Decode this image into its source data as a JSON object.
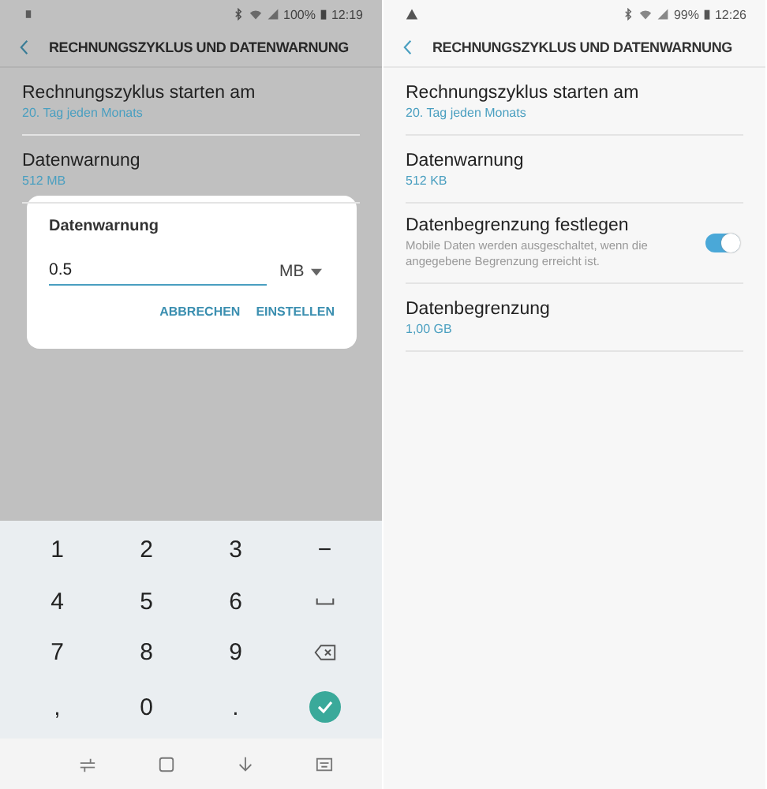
{
  "screens": [
    {
      "status": {
        "battery": "100%",
        "time": "12:19",
        "alert": false
      },
      "header": {
        "title": "RECHNUNGSZYKLUS UND DATENWARNUNG"
      },
      "dimmed": true,
      "items": [
        {
          "kind": "text",
          "title": "Rechnungszyklus starten am",
          "subtitle": "20. Tag jeden Monats"
        },
        {
          "kind": "text",
          "title": "Datenwarnung",
          "subtitle": "512 MB"
        }
      ],
      "dialog": {
        "title": "Datenwarnung",
        "value": "0.5",
        "unit": "MB",
        "buttons": [
          "ABBRECHEN",
          "EINSTELLEN"
        ]
      },
      "keyboard": {
        "keys": [
          {
            "kind": "char",
            "label": "1"
          },
          {
            "kind": "char",
            "label": "2"
          },
          {
            "kind": "char",
            "label": "3"
          },
          {
            "kind": "char",
            "label": "−"
          },
          {
            "kind": "char",
            "label": "4"
          },
          {
            "kind": "char",
            "label": "5"
          },
          {
            "kind": "char",
            "label": "6"
          },
          {
            "kind": "space"
          },
          {
            "kind": "char",
            "label": "7"
          },
          {
            "kind": "char",
            "label": "8"
          },
          {
            "kind": "char",
            "label": "9"
          },
          {
            "kind": "backspace"
          },
          {
            "kind": "char",
            "label": ","
          },
          {
            "kind": "char",
            "label": "0"
          },
          {
            "kind": "char",
            "label": "."
          },
          {
            "kind": "done"
          }
        ]
      }
    },
    {
      "status": {
        "battery": "99%",
        "time": "12:26",
        "alert": true
      },
      "header": {
        "title": "RECHNUNGSZYKLUS UND DATENWARNUNG"
      },
      "dimmed": false,
      "items": [
        {
          "kind": "text",
          "title": "Rechnungszyklus starten am",
          "subtitle": "20. Tag jeden Monats"
        },
        {
          "kind": "text",
          "title": "Datenwarnung",
          "subtitle": "512 KB"
        },
        {
          "kind": "toggle",
          "title": "Datenbegrenzung festlegen",
          "subtitle": "Mobile Daten werden ausgeschaltet, wenn die angegebene Begrenzung erreicht ist.",
          "on": true
        },
        {
          "kind": "text",
          "title": "Datenbegrenzung",
          "subtitle": "1,00 GB"
        }
      ]
    }
  ]
}
